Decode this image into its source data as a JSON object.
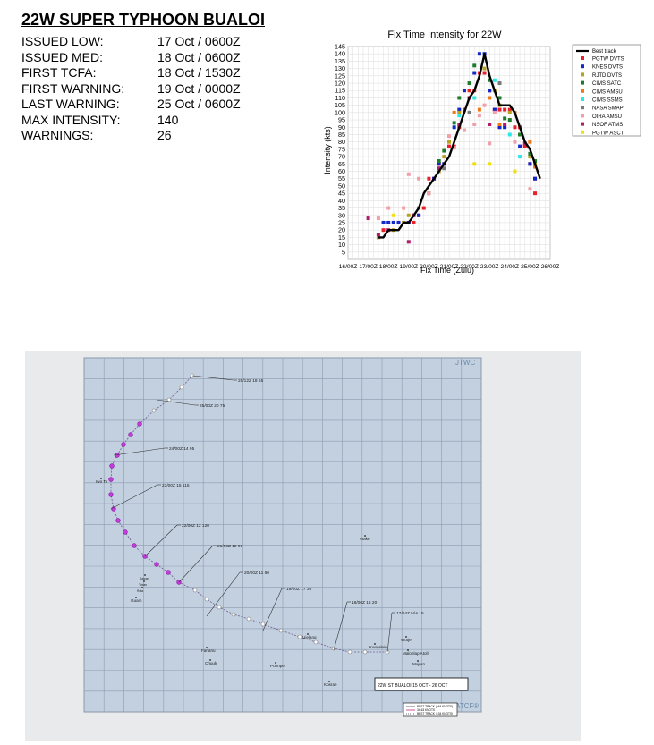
{
  "header": {
    "title": "22W SUPER TYPHOON BUALOI",
    "rows": [
      {
        "label": "ISSUED LOW:",
        "value": "17 Oct / 0600Z"
      },
      {
        "label": "ISSUED MED:",
        "value": "18 Oct / 0600Z"
      },
      {
        "label": "FIRST TCFA:",
        "value": "18 Oct / 1530Z"
      },
      {
        "label": "FIRST WARNING:",
        "value": "19 Oct / 0000Z"
      },
      {
        "label": "LAST WARNING:",
        "value": "25 Oct / 0600Z"
      },
      {
        "label": "MAX INTENSITY:",
        "value": "140"
      },
      {
        "label": "WARNINGS:",
        "value": "26"
      }
    ]
  },
  "chart_data": {
    "type": "scatter",
    "title": "Fix Time Intensity for 22W",
    "xlabel": "Fix Time (Zulu)",
    "ylabel": "Intensity (kts)",
    "xlim": [
      0,
      10
    ],
    "ylim": [
      5,
      145
    ],
    "x_ticks": [
      "16/00Z",
      "17/00Z",
      "18/00Z",
      "19/00Z",
      "20/00Z",
      "21/00Z",
      "22/00Z",
      "23/00Z",
      "24/00Z",
      "25/00Z",
      "26/00Z"
    ],
    "y_ticks": [
      5,
      10,
      15,
      20,
      25,
      30,
      35,
      40,
      45,
      50,
      55,
      60,
      65,
      70,
      75,
      80,
      85,
      90,
      95,
      100,
      105,
      110,
      115,
      120,
      125,
      130,
      135,
      140,
      145
    ],
    "grid": true,
    "legend_position": "top-right",
    "best_track": {
      "name": "Best track",
      "color": "#000000",
      "x": [
        1.5,
        1.75,
        2.0,
        2.25,
        2.5,
        2.75,
        3.0,
        3.25,
        3.5,
        3.75,
        4.0,
        4.25,
        4.5,
        4.75,
        5.0,
        5.25,
        5.5,
        5.75,
        6.0,
        6.25,
        6.5,
        6.75,
        7.0,
        7.25,
        7.5,
        7.75,
        8.0,
        8.25,
        8.5,
        8.75,
        9.0,
        9.25,
        9.5
      ],
      "y": [
        15,
        15,
        20,
        20,
        20,
        25,
        25,
        30,
        35,
        45,
        50,
        55,
        60,
        65,
        70,
        80,
        90,
        100,
        110,
        115,
        125,
        140,
        125,
        115,
        105,
        105,
        105,
        100,
        90,
        80,
        75,
        65,
        55
      ]
    },
    "series": [
      {
        "name": "PGTW DVTS",
        "color": "#e8202a",
        "points": [
          [
            1.75,
            20
          ],
          [
            2.25,
            25
          ],
          [
            2.5,
            25
          ],
          [
            3.0,
            25
          ],
          [
            3.25,
            25
          ],
          [
            3.5,
            30
          ],
          [
            3.75,
            35
          ],
          [
            4.0,
            55
          ],
          [
            4.25,
            55
          ],
          [
            4.5,
            65
          ],
          [
            4.75,
            65
          ],
          [
            5.0,
            77
          ],
          [
            5.25,
            77
          ],
          [
            5.5,
            90
          ],
          [
            5.75,
            102
          ],
          [
            6.0,
            115
          ],
          [
            6.25,
            115
          ],
          [
            6.5,
            127
          ],
          [
            6.75,
            127
          ],
          [
            7.0,
            115
          ],
          [
            7.25,
            102
          ],
          [
            7.5,
            102
          ],
          [
            7.75,
            102
          ],
          [
            8.0,
            102
          ],
          [
            8.25,
            90
          ],
          [
            8.5,
            90
          ],
          [
            8.75,
            77
          ],
          [
            9.0,
            65
          ],
          [
            9.25,
            45
          ],
          [
            9.25,
            55
          ]
        ]
      },
      {
        "name": "KNES DVTS",
        "color": "#1428c8",
        "points": [
          [
            1.75,
            25
          ],
          [
            2.0,
            25
          ],
          [
            2.25,
            25
          ],
          [
            2.5,
            25
          ],
          [
            2.75,
            25
          ],
          [
            3.0,
            25
          ],
          [
            3.25,
            30
          ],
          [
            3.5,
            30
          ],
          [
            4.0,
            45
          ],
          [
            4.25,
            55
          ],
          [
            4.5,
            65
          ],
          [
            4.75,
            65
          ],
          [
            5.25,
            90
          ],
          [
            5.5,
            102
          ],
          [
            5.75,
            115
          ],
          [
            6.25,
            127
          ],
          [
            6.5,
            140
          ],
          [
            6.75,
            140
          ],
          [
            7.0,
            115
          ],
          [
            7.25,
            102
          ],
          [
            7.5,
            90
          ],
          [
            7.75,
            90
          ],
          [
            8.5,
            77
          ],
          [
            9.0,
            65
          ],
          [
            9.25,
            55
          ]
        ]
      },
      {
        "name": "RJTD DVTS",
        "color": "#b8a020",
        "points": [
          [
            1.5,
            15
          ],
          [
            2.25,
            20
          ],
          [
            2.75,
            25
          ],
          [
            3.0,
            30
          ],
          [
            3.5,
            35
          ],
          [
            4.0,
            45
          ],
          [
            4.5,
            60
          ],
          [
            4.75,
            70
          ],
          [
            5.0,
            80
          ],
          [
            5.5,
            100
          ],
          [
            6.0,
            110
          ],
          [
            6.75,
            130
          ],
          [
            7.25,
            115
          ],
          [
            7.5,
            105
          ],
          [
            8.0,
            100
          ],
          [
            8.5,
            85
          ],
          [
            9.0,
            70
          ],
          [
            9.25,
            65
          ]
        ]
      },
      {
        "name": "CIMS SATC",
        "color": "#1c7c2c",
        "points": [
          [
            4.5,
            67
          ],
          [
            4.75,
            74
          ],
          [
            5.25,
            93
          ],
          [
            5.5,
            110
          ],
          [
            6.0,
            120
          ],
          [
            6.25,
            132
          ],
          [
            7.0,
            122
          ],
          [
            7.5,
            110
          ],
          [
            7.75,
            96
          ],
          [
            8.0,
            95
          ],
          [
            8.5,
            85
          ],
          [
            9.0,
            72
          ],
          [
            9.25,
            67
          ]
        ]
      },
      {
        "name": "CIMS AMSU",
        "color": "#f07818",
        "points": [
          [
            5.25,
            100
          ],
          [
            6.5,
            102
          ],
          [
            7.0,
            110
          ],
          [
            7.5,
            92
          ],
          [
            8.25,
            100
          ],
          [
            9.0,
            80
          ],
          [
            9.25,
            63
          ]
        ]
      },
      {
        "name": "CIMS SSMS",
        "color": "#28e8e8",
        "points": [
          [
            5.5,
            98
          ],
          [
            6.25,
            110
          ],
          [
            7.25,
            122
          ],
          [
            8.0,
            85
          ],
          [
            8.5,
            70
          ]
        ]
      },
      {
        "name": "NASA SMAP",
        "color": "#787878",
        "points": [
          [
            4.75,
            62
          ],
          [
            6.0,
            100
          ],
          [
            7.5,
            120
          ]
        ]
      },
      {
        "name": "OIRA AMSU",
        "color": "#f0a0a8",
        "points": [
          [
            1.5,
            28
          ],
          [
            2.0,
            35
          ],
          [
            2.75,
            35
          ],
          [
            3.0,
            58
          ],
          [
            3.5,
            55
          ],
          [
            4.0,
            45
          ],
          [
            5.0,
            84
          ],
          [
            5.25,
            76
          ],
          [
            5.75,
            88
          ],
          [
            6.25,
            92
          ],
          [
            6.5,
            98
          ],
          [
            6.75,
            105
          ],
          [
            7.0,
            79
          ],
          [
            7.25,
            100
          ],
          [
            8.25,
            80
          ],
          [
            9.0,
            48
          ]
        ]
      },
      {
        "name": "NSOF ATMS",
        "color": "#b01c6c",
        "points": [
          [
            1.0,
            28
          ],
          [
            1.5,
            17
          ],
          [
            2.0,
            20
          ],
          [
            3.0,
            12
          ],
          [
            3.25,
            30
          ],
          [
            4.5,
            62
          ],
          [
            5.5,
            92
          ],
          [
            6.0,
            110
          ],
          [
            7.0,
            92
          ],
          [
            7.75,
            92
          ],
          [
            8.75,
            79
          ]
        ]
      },
      {
        "name": "PGTW ASCT",
        "color": "#f0e010",
        "points": [
          [
            2.25,
            30
          ],
          [
            6.25,
            65
          ],
          [
            7.0,
            65
          ],
          [
            8.25,
            60
          ]
        ]
      }
    ]
  },
  "map": {
    "agency_top": "JTWC",
    "agency_bottom": "ATCF®",
    "legend_box": "22W ST BUALOI    15 OCT - 26 OCT",
    "legend_lines": [
      "BEST TRACK (>64 KNOTS)",
      "34-63 KNOTS",
      "BEST TRACK (<34 KNOTS)"
    ],
    "annotations": [
      "25/12Z 18  55",
      "25/00Z 20  75",
      "24/00Z 14  95",
      "23/00Z 15 115",
      "22/00Z 12 120",
      "21/00Z 12  90",
      "20/00Z 11  60",
      "19/00Z 17  30",
      "18/00Z 16  20",
      "17/04Z N/A  15"
    ],
    "places": [
      "Iwo To",
      "Wake",
      "Saipan",
      "Tinian",
      "Rota",
      "Guam",
      "Ujelang",
      "Fananu",
      "Chuuk",
      "Pohnpei",
      "Kosrae",
      "Kwajalein",
      "Wotje",
      "Maloelap Atoll",
      "Majuro"
    ]
  }
}
